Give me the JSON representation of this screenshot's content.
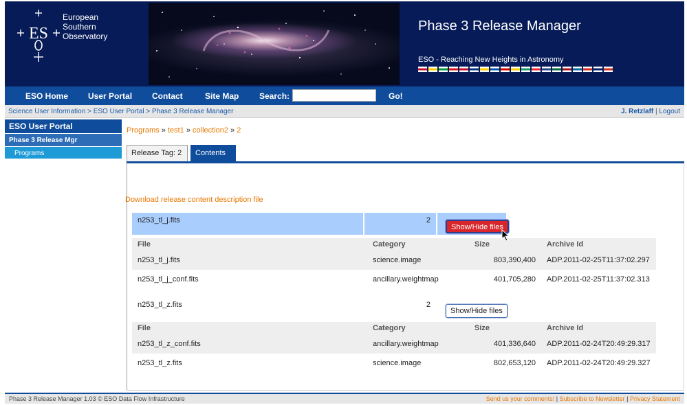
{
  "header": {
    "org_line1": "European",
    "org_line2": "Southern",
    "org_line3": "Observatory",
    "app_title": "Phase 3 Release Manager",
    "tagline": "ESO - Reaching New Heights in Astronomy",
    "flag_colors": [
      "#c8102e",
      "#ffce00",
      "#009c3b",
      "#d7141a",
      "#c60c30",
      "#003580",
      "#ffcc00",
      "#0055a4",
      "#dd0000",
      "#ffcc00",
      "#169b62",
      "#ed2939",
      "#21468b",
      "#046a38",
      "#aa151b",
      "#006aa7",
      "#d52b1e",
      "#012169",
      "#d52b1e"
    ]
  },
  "nav": {
    "home": "ESO Home",
    "portal": "User Portal",
    "contact": "Contact",
    "sitemap": "Site Map",
    "search_label": "Search:",
    "search_value": "",
    "go": "Go!"
  },
  "breadcrumb": {
    "item1": "Science User Information",
    "item2": "ESO User Portal",
    "item3": "Phase 3 Release Manager",
    "separator": " > "
  },
  "user": {
    "name": "J. Retzlaff",
    "separator": "|",
    "logout": "Logout"
  },
  "sidebar": {
    "portal": "ESO User Portal",
    "manager": "Phase 3 Release Mgr",
    "programs": "Programs"
  },
  "path": {
    "programs": "Programs",
    "sep": " » ",
    "test": "test1",
    "collection": "collection2",
    "release": "2"
  },
  "tabs": {
    "release_tag": "Release Tag: 2",
    "contents": "Contents"
  },
  "download_link": "Download release content description file",
  "toggle_label": "Show/Hide files",
  "file_table_headers": [
    "File",
    "Category",
    "Size",
    "Archive Id"
  ],
  "datasets": [
    {
      "name": "n253_tl_j.fits",
      "count": "2",
      "files": [
        {
          "file": "n253_tl_j.fits",
          "category": "science.image",
          "size": "803,390,400",
          "archive_id": "ADP.2011-02-25T11:37:02.297"
        },
        {
          "file": "n253_tl_j_conf.fits",
          "category": "ancillary.weightmap",
          "size": "401,705,280",
          "archive_id": "ADP.2011-02-25T11:37:02.313"
        }
      ]
    },
    {
      "name": "n253_tl_z.fits",
      "count": "2",
      "files": [
        {
          "file": "n253_tl_z_conf.fits",
          "category": "ancillary.weightmap",
          "size": "401,336,640",
          "archive_id": "ADP.2011-02-24T20:49:29.317"
        },
        {
          "file": "n253_tl_z.fits",
          "category": "science.image",
          "size": "802,653,120",
          "archive_id": "ADP.2011-02-24T20:49:29.327"
        }
      ]
    }
  ],
  "footer": {
    "left": "Phase 3 Release Manager 1.03 © ESO Data Flow Infrastructure",
    "comments": "Send us your comments!",
    "newsletter": "Subscribe to Newsletter",
    "privacy": "Privacy Statement",
    "sep": " | "
  },
  "colors": {
    "header_bg": "#061b57",
    "nav_bg": "#0f4c9b",
    "accent_orange": "#e87800",
    "selected_row": "#a9cdfc",
    "active_button": "#d9262a"
  }
}
